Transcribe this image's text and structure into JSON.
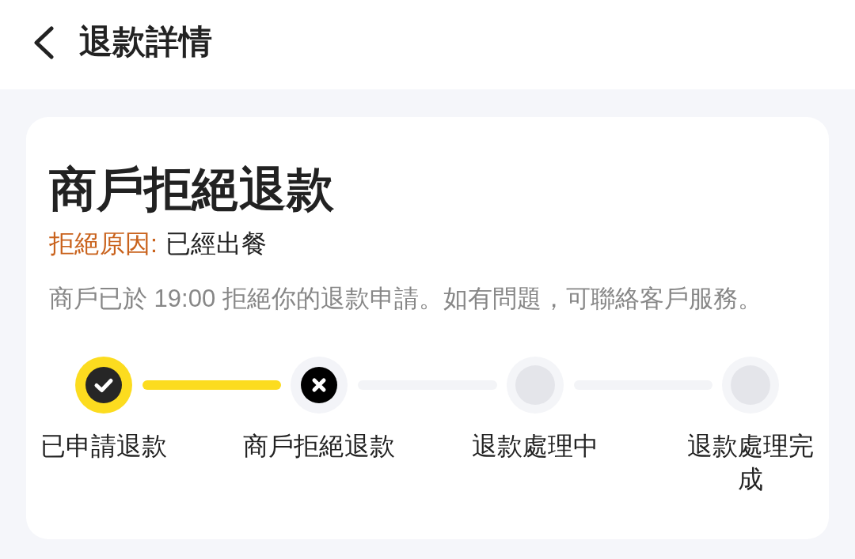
{
  "header": {
    "title": "退款詳情"
  },
  "status": {
    "title": "商戶拒絕退款",
    "reason_label": "拒絕原因:",
    "reason": "已經出餐",
    "description": "商戶已於 19:00 拒絕你的退款申請。如有問題，可聯絡客戶服務。"
  },
  "steps": [
    {
      "label": "已申請退款",
      "kind": "done"
    },
    {
      "label": "商戶拒絕退款",
      "kind": "rejected"
    },
    {
      "label": "退款處理中",
      "kind": "pending"
    },
    {
      "label": "退款處理完成",
      "kind": "pending"
    }
  ]
}
